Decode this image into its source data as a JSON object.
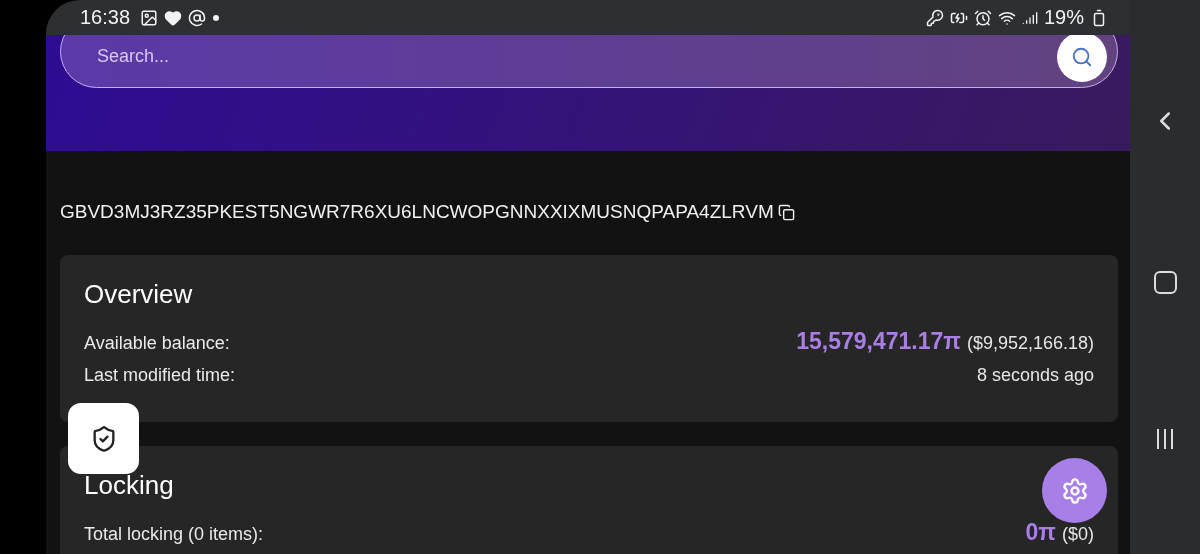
{
  "status_bar": {
    "time": "16:38",
    "battery": "19%"
  },
  "search": {
    "placeholder": "Search..."
  },
  "address": {
    "text": "GBVD3MJ3RZ35PKEST5NGWR7R6XU6LNCWOPGNNXXIXMUSNQPAPA4ZLRVM"
  },
  "cards": [
    {
      "title": "Overview",
      "rows": [
        {
          "label": "Available balance:",
          "value": "15,579,471.17π",
          "fiat": "($9,952,166.18)"
        },
        {
          "label": "Last modified time:",
          "text": "8 seconds ago"
        }
      ]
    },
    {
      "title": "Locking",
      "rows": [
        {
          "label": "Total locking (0 items):",
          "value": "0π",
          "fiat": "($0)"
        }
      ]
    }
  ]
}
